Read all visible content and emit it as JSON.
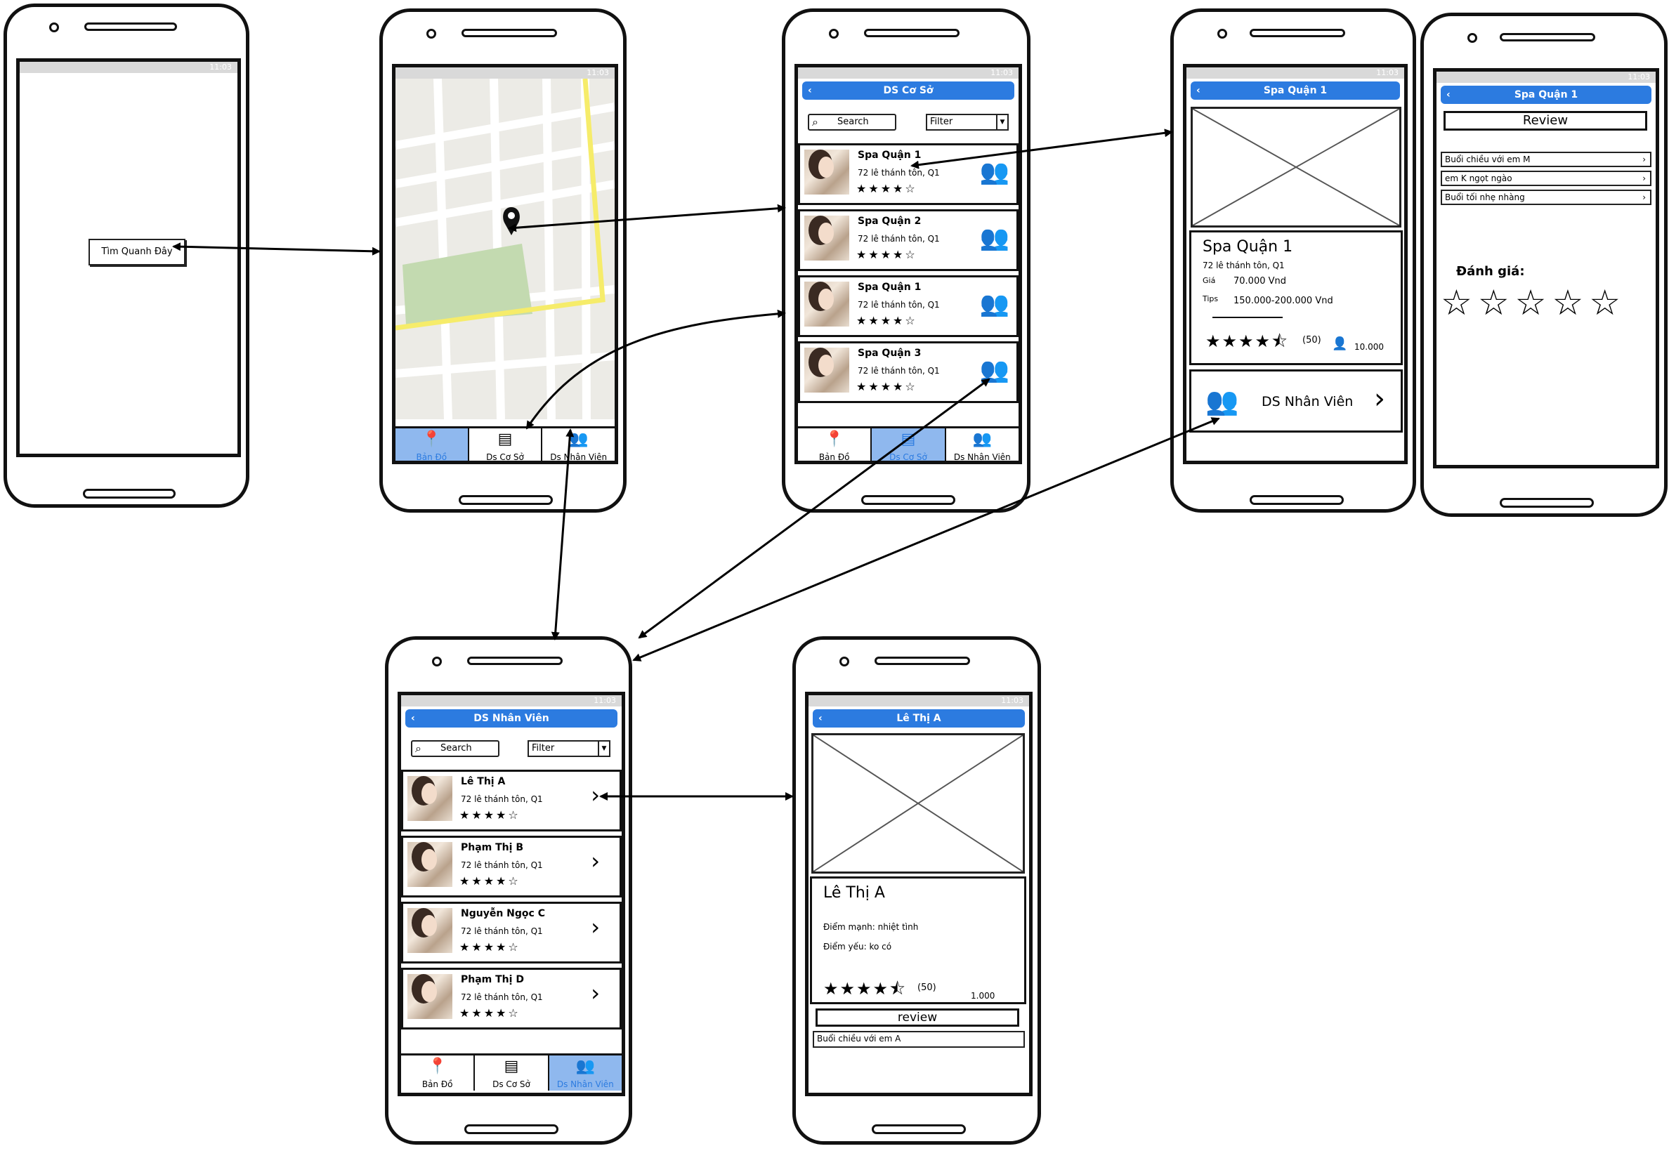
{
  "status_time": "11:03",
  "phone1": {
    "button": "Tìm Quanh Đây"
  },
  "tabs": {
    "map": "Bản Đồ",
    "shops": "Ds Cơ Sở",
    "staff": "Ds Nhân Viên"
  },
  "list_common": {
    "search": "Search",
    "filter": "Filter"
  },
  "shops_screen": {
    "title": "DS Cơ Sở",
    "items": [
      {
        "name": "Spa Quận 1",
        "addr": "72 lê thánh tôn, Q1",
        "stars": "★★★★☆"
      },
      {
        "name": "Spa Quận 2",
        "addr": "72 lê thánh tôn, Q1",
        "stars": "★★★★☆"
      },
      {
        "name": "Spa Quận 1",
        "addr": "72 lê thánh tôn, Q1",
        "stars": "★★★★☆"
      },
      {
        "name": "Spa Quận 3",
        "addr": "72 lê thánh tôn, Q1",
        "stars": "★★★★☆"
      }
    ]
  },
  "shop_detail": {
    "header": "Spa Quận 1",
    "name": "Spa Quận 1",
    "addr": "72 lê thánh tôn, Q1",
    "price_label": "Giá",
    "price": "70.000 Vnd",
    "tips_label": "Tips",
    "tips": "150.000-200.000 Vnd",
    "rating_stars": "★★★★⯪",
    "rating_count": "(50)",
    "count": "10.000",
    "staff_button": "DS Nhân Viên"
  },
  "review_screen": {
    "header": "Spa Quận 1",
    "review_button": "Review",
    "items": [
      "Buổi chiều với em M",
      "em K ngọt ngào",
      "Buổi tối nhẹ nhàng"
    ],
    "rating_label": "Đánh giá:",
    "stars": "☆☆☆☆☆"
  },
  "staff_screen": {
    "title": "DS Nhân Viên",
    "items": [
      {
        "name": "Lê Thị A",
        "addr": "72 lê thánh tôn, Q1",
        "stars": "★★★★☆"
      },
      {
        "name": "Phạm Thị B",
        "addr": "72 lê thánh tôn, Q1",
        "stars": "★★★★☆"
      },
      {
        "name": "Nguyễn Ngọc C",
        "addr": "72 lê thánh tôn, Q1",
        "stars": "★★★★☆"
      },
      {
        "name": "Phạm Thị D",
        "addr": "72 lê thánh tôn, Q1",
        "stars": "★★★★☆"
      }
    ]
  },
  "staff_detail": {
    "header": "Lê Thị A",
    "name": "Lê Thị A",
    "strength": "Điểm mạnh: nhiệt tình",
    "weakness": "Điểm yếu: ko có",
    "rating_stars": "★★★★⯪",
    "rating_count": "(50)",
    "count": "1.000",
    "review_button": "review",
    "review_item": "Buổi chiều với em A"
  },
  "colors": {
    "accent": "#2c7be0",
    "tab_active": "#8fb8ee",
    "map_park": "#c3dab0",
    "map_road": "#f6ec6a"
  }
}
